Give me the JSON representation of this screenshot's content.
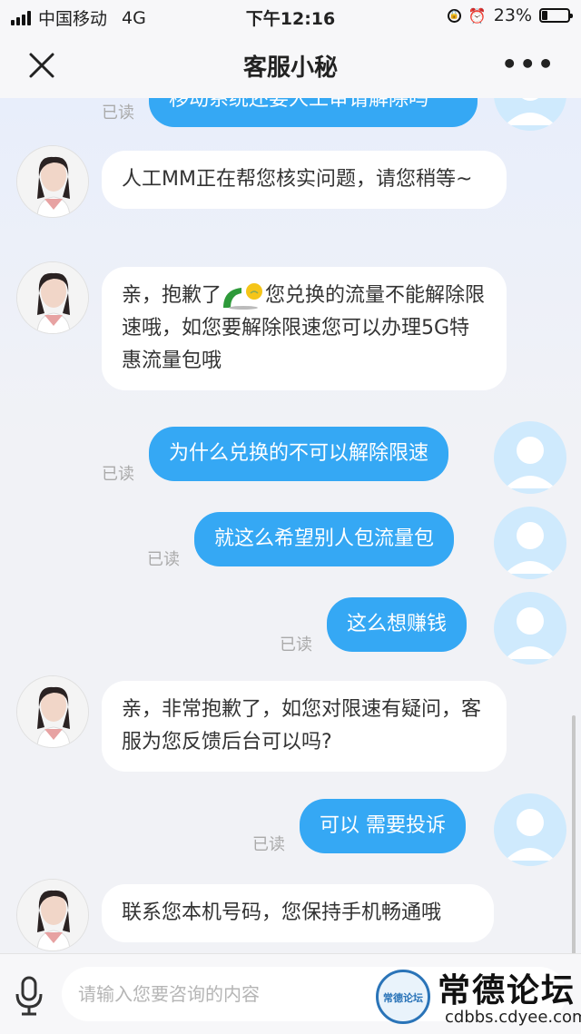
{
  "status_bar": {
    "carrier": "中国移动",
    "network": "4G",
    "time": "下午12:16",
    "battery": "23%",
    "battery_level": 0.23
  },
  "nav": {
    "title": "客服小秘",
    "close_icon": "close-icon",
    "more_icon": "more-icon"
  },
  "messages": [
    {
      "from": "user",
      "text": "移动系统还要人工审请解除吗",
      "read": "已读"
    },
    {
      "from": "agent",
      "text": "人工MM正在帮您核实问题，请您稍等~"
    },
    {
      "from": "agent",
      "text_before": "亲，抱歉了",
      "emoji": "sorry-emoji",
      "text_after": "您兑换的流量不能解除限速哦，如您要解除限速您可以办理5G特惠流量包哦"
    },
    {
      "from": "user",
      "text": "为什么兑换的不可以解除限速",
      "read": "已读"
    },
    {
      "from": "user",
      "text": "就这么希望别人包流量包",
      "read": "已读"
    },
    {
      "from": "user",
      "text": "这么想赚钱",
      "read": "已读"
    },
    {
      "from": "agent",
      "text": "亲，非常抱歉了，如您对限速有疑问，客服为您反馈后台可以吗?"
    },
    {
      "from": "user",
      "text": "可以 需要投诉",
      "read": "已读"
    },
    {
      "from": "agent",
      "text": "联系您本机号码，您保持手机畅通哦"
    }
  ],
  "input": {
    "placeholder": "请输入您要咨询的内容",
    "mic_icon": "microphone-icon"
  },
  "watermark": {
    "name": "常德论坛",
    "url": "cdbbs.cdyee.com",
    "badge": "常德论坛"
  }
}
